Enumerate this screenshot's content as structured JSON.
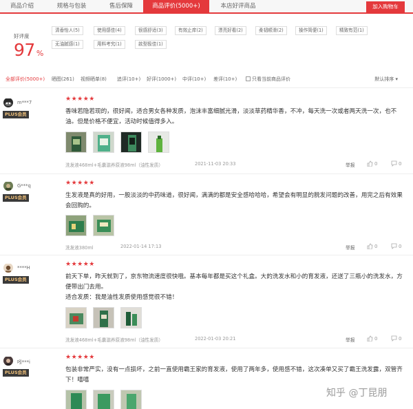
{
  "tabs": [
    {
      "label": "商品介绍",
      "active": false
    },
    {
      "label": "规格与包装",
      "active": false
    },
    {
      "label": "售后保障",
      "active": false
    },
    {
      "label": "商品评价(5000+)",
      "active": true
    },
    {
      "label": "本店好评商品",
      "active": false
    }
  ],
  "cart_button": "加入购物车",
  "rating": {
    "label": "好评度",
    "value": "97",
    "unit": "%",
    "tags": [
      "清香怡人(5)",
      "使用感佳(4)",
      "很感舒适(3)",
      "有效止痒(2)",
      "漂亮好看(2)",
      "柔韧顺滑(2)",
      "操作简便(1)",
      "精致有范(1)",
      "无油腻感(1)",
      "用料考究(1)",
      "款型极佳(1)"
    ]
  },
  "filters": {
    "items": [
      "全部评价(5000+)",
      "晒图(261)",
      "视频晒单(8)",
      "追评(10+)",
      "好评(1000+)",
      "中评(10+)",
      "差评(10+)"
    ],
    "only_current": "只看当前商品评价",
    "sort": "默认排序"
  },
  "reviews": [
    {
      "user": "m***7",
      "badge": "PLUS会员",
      "stars": "★★★★★",
      "content": "香味若隐若现的，很好闻，适合男女各种发质，泡沫丰富细腻光滑，淡淡草药精华香，不冲，每天洗一次或者两天洗一次，也不油。但是价格不便宜，活动时候值得多入。",
      "spec": "洗发液468ml+毛囊滋养原液98ml（油性发质）",
      "date": "2021-11-03 20:33",
      "report": "举报",
      "likes": "0",
      "comments": "0"
    },
    {
      "user": "G***q",
      "badge": "PLUS会员",
      "stars": "★★★★★",
      "content": "生发液是真的好用，一股淡淡的中药味道，很好闻，满满的都是安全感哈哈哈，希望会有明显的脱发问题的改善，用完之后有效果会回购的。",
      "spec": "洗发液380ml",
      "date": "2022-01-14 17:13",
      "report": "举报",
      "likes": "0",
      "comments": "0"
    },
    {
      "user": "****H",
      "badge": "PLUS会员",
      "stars": "★★★★★",
      "content": "前天下单，昨天就到了，京东物流速度很快哦。基本每年都是买这个礼盒。大的洗发水和小的育发液，还送了三瓶小的洗发水，方便带出门去用。",
      "content2": "适合发质：我是油性发质使用感觉很不错！",
      "spec": "洗发液468ml+毛囊滋养原液98ml（油性发质）",
      "date": "2022-01-03 20:21",
      "report": "举报",
      "likes": "0",
      "comments": "0"
    },
    {
      "user": "吲***i",
      "badge": "PLUS会员",
      "stars": "★★★★★",
      "content": "包装非常严实，没有一点损坏，之前一直使用霸王家的育发液，使用了两年多，使用感不错，这次凑单又买了霸王洗发露，双管齐下！嘻嘻"
    }
  ],
  "watermark": "知乎 @丁昆朋",
  "colors": {
    "accent": "#e4393c",
    "plus_bg": "#3a3a3a",
    "plus_text": "#f3c27a"
  }
}
